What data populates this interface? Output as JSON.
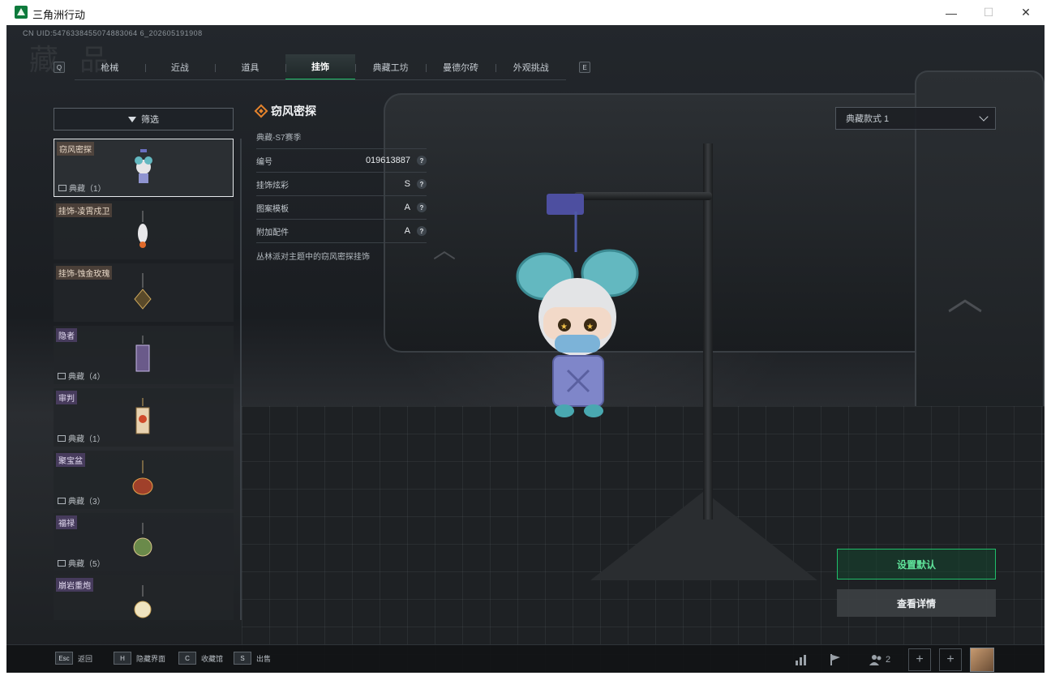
{
  "window": {
    "title": "三角洲行动",
    "minimize_glyph": "—",
    "maximize_glyph": "☐",
    "close_glyph": "✕"
  },
  "header": {
    "uid": "CN UID:5476338455074883064 6_202605191908",
    "big_title": "藏 品"
  },
  "tabs": {
    "left_key": "Q",
    "right_key": "E",
    "items": [
      {
        "label": "枪械",
        "active": false
      },
      {
        "label": "近战",
        "active": false
      },
      {
        "label": "道具",
        "active": false
      },
      {
        "label": "挂饰",
        "active": true
      },
      {
        "label": "典藏工坊",
        "active": false
      },
      {
        "label": "曼德尔砖",
        "active": false
      },
      {
        "label": "外观挑战",
        "active": false
      }
    ]
  },
  "filter": {
    "label": "筛选"
  },
  "list": {
    "items": [
      {
        "name": "窃风密探",
        "footer": "典藏（1）",
        "selected": true,
        "name_style": "brown"
      },
      {
        "name": "挂饰-凌霄戍卫",
        "footer": "",
        "selected": false,
        "name_style": "brown"
      },
      {
        "name": "挂饰-蚀金玫瑰",
        "footer": "",
        "selected": false,
        "name_style": "brown"
      },
      {
        "name": "隐者",
        "footer": "典藏（4）",
        "selected": false,
        "name_style": "purple"
      },
      {
        "name": "审判",
        "footer": "典藏（1）",
        "selected": false,
        "name_style": "purple"
      },
      {
        "name": "聚宝盆",
        "footer": "典藏（3）",
        "selected": false,
        "name_style": "purple"
      },
      {
        "name": "福禄",
        "footer": "典藏（5）",
        "selected": false,
        "name_style": "purple"
      },
      {
        "name": "崩岩重炮",
        "footer": "",
        "selected": false,
        "name_style": "purple"
      }
    ]
  },
  "detail": {
    "title": "窃风密探",
    "season": "典藏-S7赛季",
    "rows": [
      {
        "label": "编号",
        "value": "019613887"
      },
      {
        "label": "挂饰炫彩",
        "value": "S"
      },
      {
        "label": "图案模板",
        "value": "A"
      },
      {
        "label": "附加配件",
        "value": "A"
      }
    ],
    "description": "丛林派对主题中的窃风密探挂饰"
  },
  "style_select": {
    "value": "典藏款式 1"
  },
  "actions": {
    "set_default": "设置默认",
    "view_details": "查看详情"
  },
  "bottom_bar": {
    "hints": [
      {
        "key": "Esc",
        "label": "返回"
      },
      {
        "key": "H",
        "label": "隐藏界面"
      },
      {
        "key": "C",
        "label": "收藏馆"
      },
      {
        "key": "S",
        "label": "出售"
      }
    ],
    "party_count": "2",
    "plus_glyph": "+"
  },
  "colors": {
    "accent_green": "#1fbf6a",
    "rarity_orange": "#e4832c"
  }
}
